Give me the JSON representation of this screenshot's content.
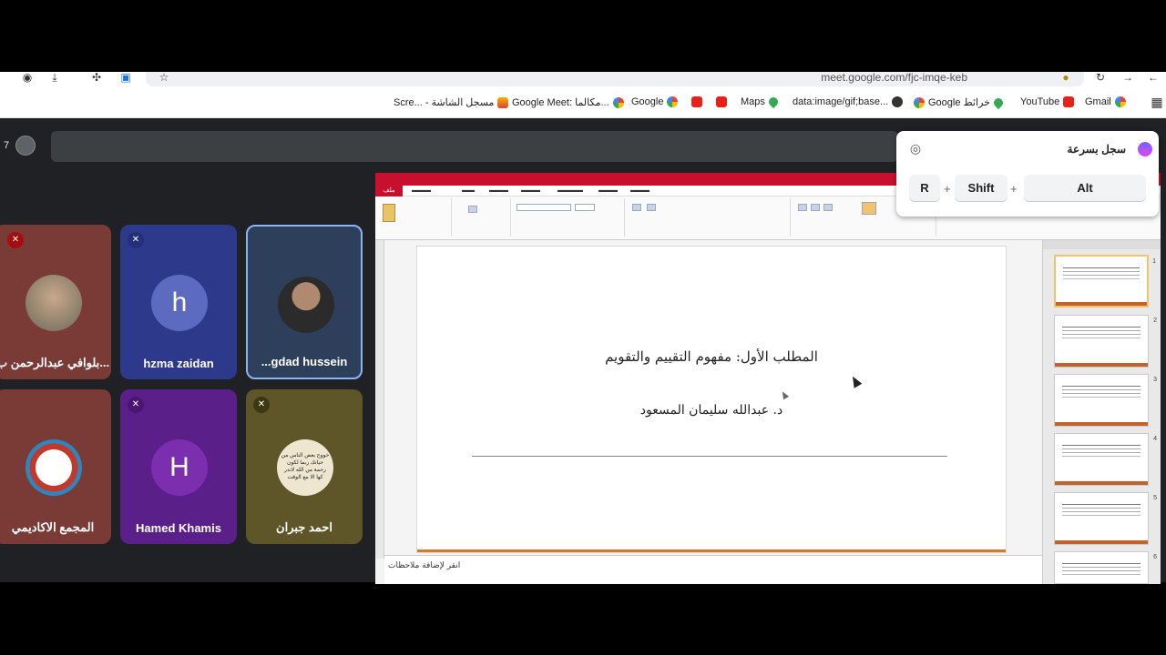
{
  "browser": {
    "url": "meet.google.com/fjc-imqe-keb",
    "bookmarks": [
      {
        "label": "Scre... - مسجل الشاشة",
        "icon": "image-icon"
      },
      {
        "label": "Google Meet: مكالما...",
        "icon": "google-icon"
      },
      {
        "label": "Google",
        "icon": "google-icon"
      },
      {
        "label": "",
        "icon": "youtube-icon"
      },
      {
        "label": "",
        "icon": "youtube-icon"
      },
      {
        "label": "Maps",
        "icon": "maps-icon"
      },
      {
        "label": "data:image/gif;base...",
        "icon": "globe-icon"
      },
      {
        "label": "Google خرائط",
        "icon": "google-icon"
      },
      {
        "label": "YouTube",
        "icon": "youtube-icon"
      },
      {
        "label": "Gmail",
        "icon": "gmail-icon"
      }
    ]
  },
  "meet": {
    "participant_count": "7",
    "participants": [
      {
        "name": "بلوافي عبدالرحمن ب...",
        "muted": true,
        "avatar_letter": ""
      },
      {
        "name": "hzma zaidan",
        "muted": true,
        "avatar_letter": "h"
      },
      {
        "name": "...gdad hussein",
        "muted": false,
        "avatar_letter": ""
      },
      {
        "name": "المجمع الاكاديمي",
        "muted": false,
        "avatar_letter": ""
      },
      {
        "name": "Hamed Khamis",
        "muted": true,
        "avatar_letter": "H"
      },
      {
        "name": "احمد جبران",
        "muted": true,
        "avatar_letter": ""
      }
    ],
    "tile_avatar_caption": "خووج بعض الناس من حياتك ربما لكون رحمة من الله لاتدر كها الا مع الوقت"
  },
  "shared_screen": {
    "file_tab": "ملف",
    "slide_line1": "ﺍﻟﻤﻄﻠﺐ ﺍﻷﻭﻝ: ﻣﻔﻬﻮﻡ ﺍﻟﺘﻘﻴﻴﻢ ﻭﺍﻟﺘﻘﻮﻳﻢ",
    "slide_line2": "ﺩ. ﻋﺒﺪﺍﻟﻠﻪ ﺳﻠﻴﻤﺎﻥ ﺍﻟﻤﺴﻌﻮﺩ",
    "notes_text": "ﺍﻧﻘﺮ ﻹﺿﺎﻓﺔ ﻣﻼﺣﻈﺎﺕ",
    "thumb_numbers": [
      "1",
      "2",
      "3",
      "4",
      "5",
      "6"
    ]
  },
  "quick_record": {
    "title": "سجل بسرعة",
    "keys": [
      "R",
      "Shift",
      "Alt"
    ],
    "plus": "+"
  }
}
